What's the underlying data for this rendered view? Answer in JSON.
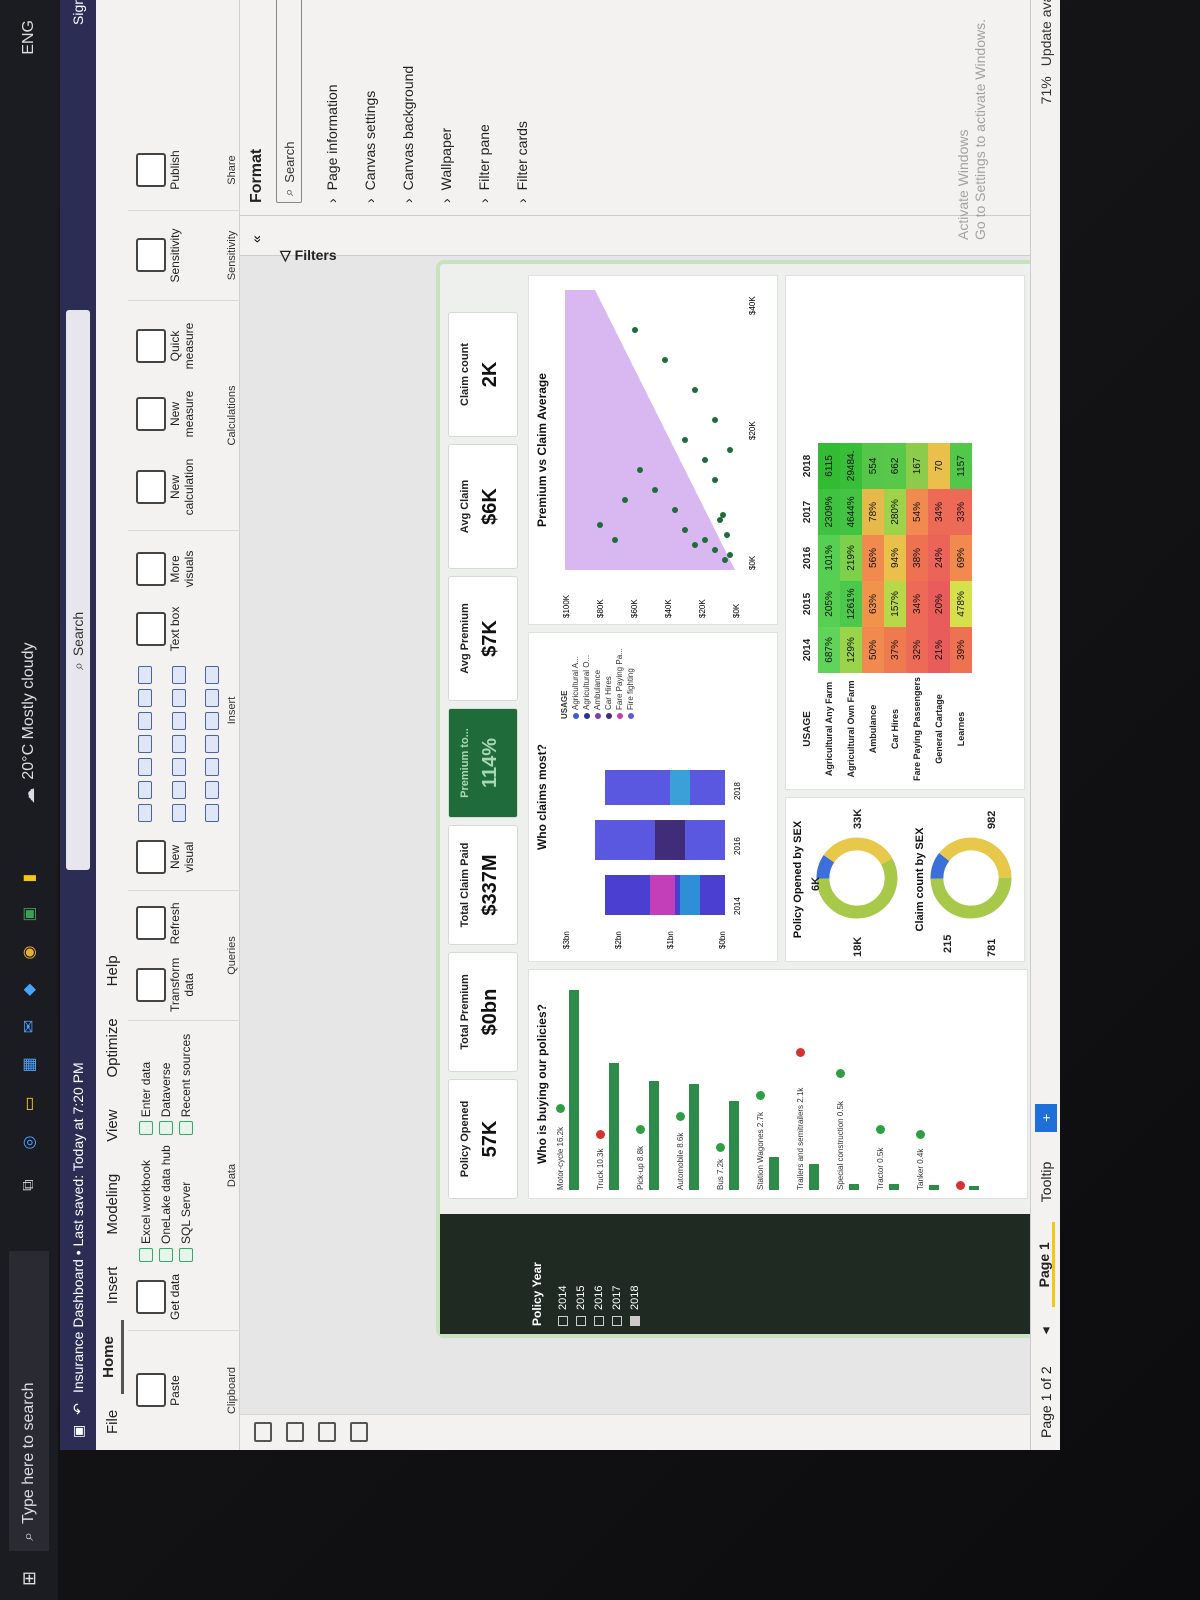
{
  "titlebar": {
    "title": "Insurance Dashboard • Last saved: Today at 7:20 PM",
    "search": "Search",
    "signin": "Sign in"
  },
  "menu": [
    "File",
    "Home",
    "Insert",
    "Modeling",
    "View",
    "Optimize",
    "Help"
  ],
  "ribbon": {
    "clipboard": {
      "paste": "Paste",
      "name": "Clipboard"
    },
    "data": {
      "get_data": "Get data",
      "excel": "Excel workbook",
      "onelake": "OneLake data hub",
      "sql": "SQL Server",
      "enter": "Enter data",
      "dataverse": "Dataverse",
      "recent": "Recent sources",
      "name": "Data"
    },
    "queries": {
      "transform": "Transform data",
      "refresh": "Refresh",
      "name": "Queries"
    },
    "insert": {
      "new_visual": "New visual",
      "text_box": "Text box",
      "more_visuals": "More visuals",
      "name": "Insert"
    },
    "calculations": {
      "new_calc": "New calculation",
      "new_measure": "New measure",
      "quick_measure": "Quick measure",
      "name": "Calculations"
    },
    "sensitivity": {
      "label": "Sensitivity",
      "name": "Sensitivity"
    },
    "share": {
      "publish": "Publish",
      "name": "Share"
    }
  },
  "dashboard": {
    "slicer": {
      "title": "Policy Year",
      "years": [
        "2014",
        "2015",
        "2016",
        "2017",
        "2018"
      ]
    },
    "kpis": [
      {
        "label": "Policy Opened",
        "value": "57K"
      },
      {
        "label": "Total Premium",
        "value": "$0bn"
      },
      {
        "label": "Total Claim Paid",
        "value": "$337M"
      },
      {
        "label": "Premium to...",
        "value": "114%"
      },
      {
        "label": "Avg Premium",
        "value": "$7K"
      },
      {
        "label": "Avg Claim",
        "value": "$6K"
      },
      {
        "label": "Claim count",
        "value": "2K"
      }
    ],
    "who_buying": {
      "title": "Who is buying our policies?",
      "rows": [
        {
          "label": "Motor-cycle 16.2k",
          "value": 16.2,
          "dot": "#2e9e45"
        },
        {
          "label": "Truck 10.3k",
          "value": 10.3,
          "dot": "#d93030"
        },
        {
          "label": "Pick-up 8.8k",
          "value": 8.8,
          "dot": "#2e9e45"
        },
        {
          "label": "Automobile 8.6k",
          "value": 8.6,
          "dot": "#2e9e45"
        },
        {
          "label": "Bus 7.2k",
          "value": 7.2,
          "dot": "#2e9e45"
        },
        {
          "label": "Station Wagones 2.7k",
          "value": 2.7,
          "dot": "#2e9e45"
        },
        {
          "label": "Trailers and semitrailers 2.1k",
          "value": 2.1,
          "dot": "#d93030"
        },
        {
          "label": "Special construction 0.5k",
          "value": 0.5,
          "dot": "#2e9e45"
        },
        {
          "label": "Tractor 0.5k",
          "value": 0.5,
          "dot": "#2e9e45"
        },
        {
          "label": "Tanker 0.4k",
          "value": 0.4,
          "dot": "#2e9e45"
        },
        {
          "label": "",
          "value": 0.1,
          "dot": "#d93030"
        }
      ]
    },
    "who_claims": {
      "title": "Who claims most?",
      "y_ticks": [
        "$3bn",
        "$2bn",
        "$1bn",
        "$0bn"
      ],
      "x_ticks": [
        "2014",
        "2016",
        "2018"
      ],
      "legend_title": "USAGE",
      "legend": [
        {
          "name": "Agricultural A...",
          "color": "#3b5bdb"
        },
        {
          "name": "Agricultural O...",
          "color": "#2b2f8f"
        },
        {
          "name": "Ambulance",
          "color": "#7b3fa8"
        },
        {
          "name": "Car Hires",
          "color": "#3f2d7a"
        },
        {
          "name": "Fare Paying Pa...",
          "color": "#c23fb8"
        },
        {
          "name": "Fire fighting",
          "color": "#5a57e0"
        }
      ]
    },
    "scatter": {
      "title": "Premium vs Claim Average",
      "y_ticks": [
        "$100K",
        "$80K",
        "$60K",
        "$40K",
        "$20K",
        "$0K"
      ],
      "x_ticks": [
        "$0K",
        "$20K",
        "$40K"
      ]
    },
    "sex_opened": {
      "title": "Policy Opened by SEX",
      "labels": [
        "6K",
        "18K",
        "33K"
      ],
      "fractions": [
        0.1,
        0.32,
        0.58
      ]
    },
    "sex_claims": {
      "title": "Claim count by SEX",
      "labels": [
        "215",
        "781",
        "982"
      ],
      "fractions": [
        0.11,
        0.39,
        0.5
      ]
    },
    "matrix": {
      "corner": "USAGE",
      "years": [
        "2014",
        "2015",
        "2016",
        "2017",
        "2018"
      ],
      "rows": [
        {
          "label": "Agricultural Any Farm",
          "cells": [
            "687%",
            "205%",
            "101%",
            "2309%",
            "6115"
          ]
        },
        {
          "label": "Agricultural Own Farm",
          "cells": [
            "129%",
            "1261%",
            "219%",
            "4644%",
            "29484."
          ]
        },
        {
          "label": "Ambulance",
          "cells": [
            "50%",
            "63%",
            "56%",
            "78%",
            "554"
          ]
        },
        {
          "label": "Car Hires",
          "cells": [
            "37%",
            "157%",
            "94%",
            "280%",
            "662"
          ]
        },
        {
          "label": "Fare Paying Passengers",
          "cells": [
            "32%",
            "34%",
            "38%",
            "54%",
            "167"
          ]
        },
        {
          "label": "General Cartage",
          "cells": [
            "21%",
            "20%",
            "24%",
            "34%",
            "70"
          ]
        },
        {
          "label": "Learnes",
          "cells": [
            "39%",
            "478%",
            "69%",
            "33%",
            "1157"
          ]
        }
      ],
      "colors": [
        [
          "#5fd35a",
          "#57cf52",
          "#57cf52",
          "#3fc23f",
          "#33bb33"
        ],
        [
          "#9ad44a",
          "#4cc84c",
          "#7ed04a",
          "#42c442",
          "#38be38"
        ],
        [
          "#f08a4e",
          "#f0944c",
          "#f08a4e",
          "#e6b94a",
          "#56c64a"
        ],
        [
          "#f07a50",
          "#b8d84a",
          "#e8c04a",
          "#9ed24a",
          "#58c84a"
        ],
        [
          "#ec6a56",
          "#ec6a56",
          "#ee7252",
          "#f08a4e",
          "#8ccc4a"
        ],
        [
          "#e85c5c",
          "#e85c5c",
          "#ea645a",
          "#ec6a56",
          "#e8c04a"
        ],
        [
          "#ee7252",
          "#d6e04a",
          "#f08a4e",
          "#ec6a56",
          "#52c84a"
        ]
      ]
    }
  },
  "filters_label": "Filters",
  "format_pane": {
    "title": "Format",
    "search": "Search",
    "sections": [
      "Page information",
      "Canvas settings",
      "Canvas background",
      "Wallpaper",
      "Filter pane",
      "Filter cards"
    ]
  },
  "pages": {
    "status": "Page 1 of 2",
    "tabs": [
      "Page 1",
      "Tooltip"
    ],
    "zoom": "71%",
    "update": "Update available"
  },
  "taskbar": {
    "search": "Type here to search",
    "weather": "20°C  Mostly cloudy",
    "lang": "ENG"
  },
  "watermark": {
    "line1": "Activate Windows",
    "line2": "Go to Settings to activate Windows."
  }
}
